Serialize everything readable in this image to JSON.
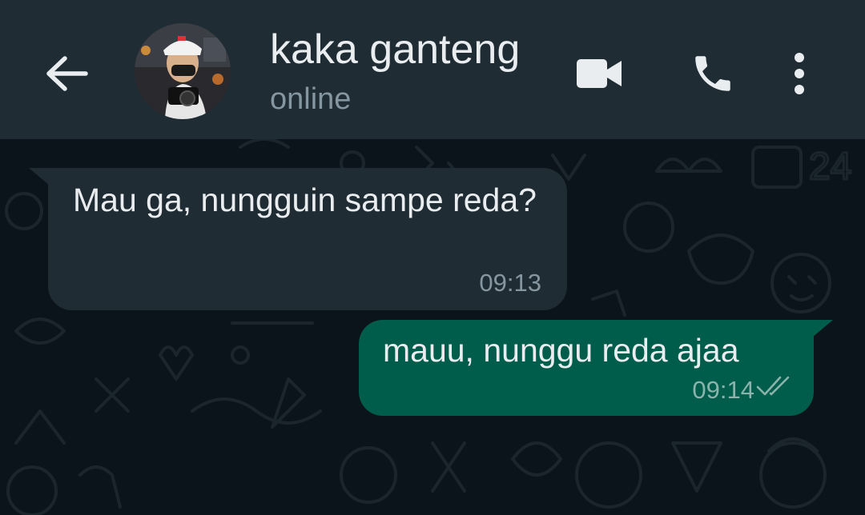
{
  "header": {
    "contact_name": "kaka ganteng",
    "status": "online",
    "icons": [
      "back-arrow-icon",
      "avatar",
      "video-call-icon",
      "phone-icon",
      "more-options-icon"
    ]
  },
  "messages": [
    {
      "direction": "incoming",
      "text": "Mau ga, nungguin sampe reda?",
      "time": "09:13"
    },
    {
      "direction": "outgoing",
      "text": "mauu, nunggu reda ajaa",
      "time": "09:14",
      "status_icon": "double-check-icon"
    }
  ],
  "colors": {
    "header_bg": "#1f2c34",
    "chat_bg": "#0b141a",
    "incoming_bubble": "#202c33",
    "outgoing_bubble": "#005c4b",
    "primary_text": "#e9edef",
    "secondary_text": "#8696a0"
  }
}
